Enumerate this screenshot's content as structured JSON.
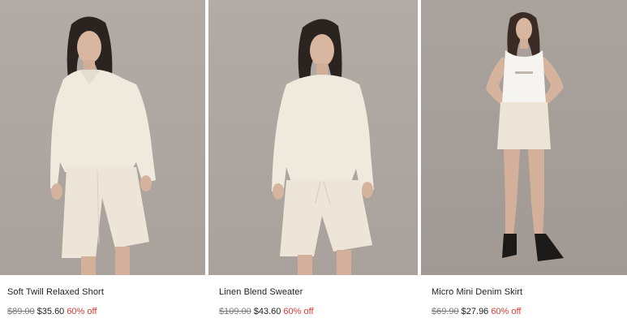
{
  "products": [
    {
      "name": "Soft Twill Relaxed Short",
      "price_original": "$89.00",
      "price_sale": "$35.60",
      "discount": "60% off"
    },
    {
      "name": "Linen Blend Sweater",
      "price_original": "$109.00",
      "price_sale": "$43.60",
      "discount": "60% off"
    },
    {
      "name": "Micro Mini Denim Skirt",
      "price_original": "$69.90",
      "price_sale": "$27.96",
      "discount": "60% off"
    }
  ],
  "colors": {
    "photo_bg": "#aea6a0",
    "garment_cream": "#efe8dc",
    "discount_red": "#e03a2f",
    "strike_grey": "#7a7a7a"
  }
}
